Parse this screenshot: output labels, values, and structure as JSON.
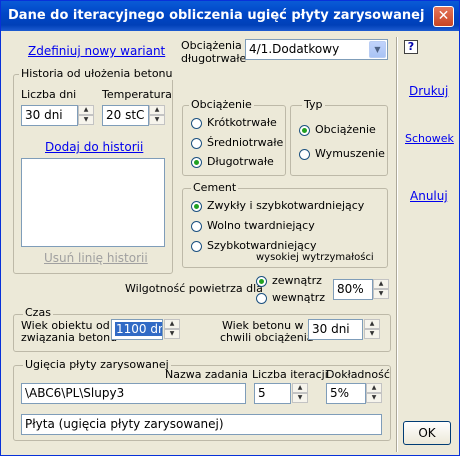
{
  "window": {
    "title": "Dane do iteracyjnego obliczenia ugięć płyty zarysowanej"
  },
  "links": {
    "define_variant": "Zdefiniuj nowy wariant",
    "add_history": "Dodaj do historii",
    "remove_history": "Usuń linię historii",
    "print": "Drukuj",
    "clipboard": "Schowek",
    "cancel": "Anuluj"
  },
  "long_term_load": {
    "label_line1": "Obciążenia",
    "label_line2": "długotrwałe",
    "value": "4/1.Dodatkowy"
  },
  "history": {
    "legend": "Historia od ułożenia betonu",
    "days_label": "Liczba dni",
    "days_value": "30 dni",
    "temp_label": "Temperatura",
    "temp_value": "20 stC"
  },
  "load_group": {
    "legend": "Obciążenie",
    "opt1": "Krótkotrwałe",
    "opt2": "Średniotrwałe",
    "opt3": "Długotrwałe",
    "selected": 3
  },
  "type_group": {
    "legend": "Typ",
    "opt1": "Obciążenie",
    "opt2": "Wymuszenie",
    "selected": 1
  },
  "cement_group": {
    "legend": "Cement",
    "opt1": "Zwykły i szybkotwardniejący",
    "opt2": "Wolno twardniejący",
    "opt3": "Szybkotwardniejący",
    "opt3_note": "wysokiej wytrzymałości",
    "selected": 1
  },
  "humidity": {
    "label": "Wilgotność powietrza dla",
    "opt1": "zewnątrz",
    "opt2": "wewnątrz",
    "selected": 1,
    "value": "80%"
  },
  "time_group": {
    "legend": "Czas",
    "age_label_line1": "Wiek obiektu od",
    "age_label_line2": "związania betonu",
    "age_value": "1100 dni",
    "concrete_label_line1": "Wiek betonu w",
    "concrete_label_line2": "chwili obciążenia",
    "concrete_value": "30 dni"
  },
  "deflection_group": {
    "legend": "Ugięcia płyty zarysowanej",
    "task_label": "Nazwa zadania",
    "task_value": "\\ABC6\\PL\\Slupy3",
    "iter_label": "Liczba iteracji",
    "iter_value": "5",
    "precision_label": "Dokładność",
    "precision_value": "5%",
    "description": "Płyta (ugięcia płyty zarysowanej)"
  },
  "buttons": {
    "help": "?",
    "ok": "OK"
  },
  "icons": {
    "close": "close-icon",
    "dropdown": "chevron-down-icon",
    "spin_up": "spin-up-icon",
    "spin_down": "spin-down-icon"
  }
}
